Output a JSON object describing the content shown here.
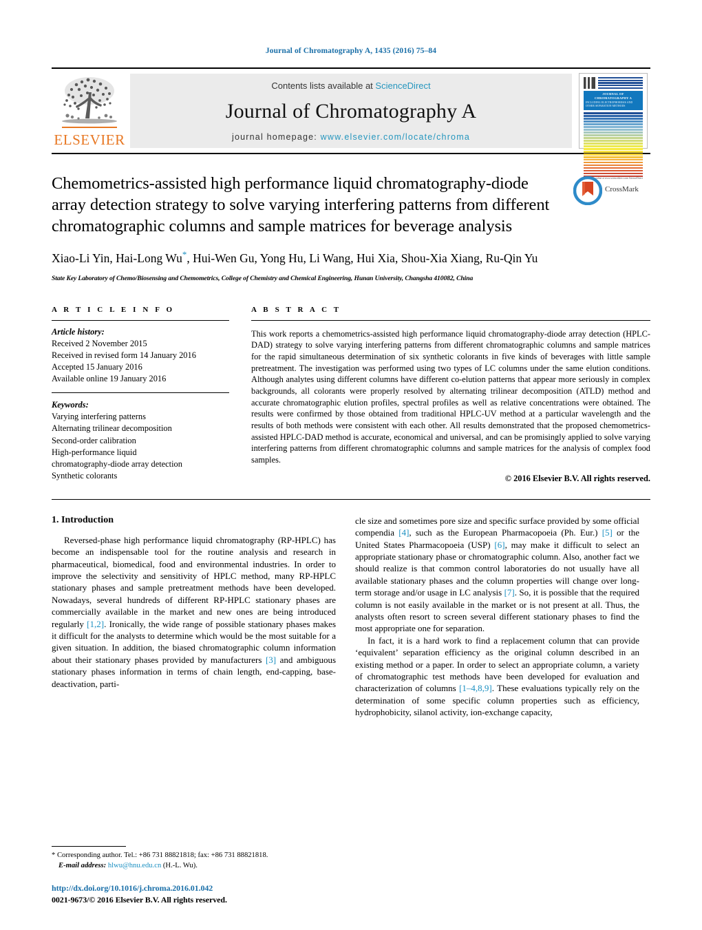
{
  "running_head": "Journal of Chromatography A, 1435 (2016) 75–84",
  "masthead": {
    "publisher_wordmark": "ELSEVIER",
    "contents_prefix": "Contents lists available at",
    "contents_link": "ScienceDirect",
    "journal_title": "Journal of Chromatography A",
    "homepage_prefix": "journal homepage:",
    "homepage_url": "www.elsevier.com/locate/chroma",
    "cover": {
      "title": "JOURNAL OF CHROMATOGRAPHY A",
      "subtitle": "INCLUDING ELECTROPHORESIS AND OTHER SEPARATION METHODS",
      "footer": "Available online at www.sciencedirect.com ScienceDirect",
      "stripe_colors": [
        "#1f4e96",
        "#2a62a8",
        "#3a78b8",
        "#4f8fc4",
        "#66a3cd",
        "#7fb4d4",
        "#94c0cf",
        "#a8c9be",
        "#b6cfa6",
        "#c3d58d",
        "#d2dc78",
        "#e0e263",
        "#ecea4f",
        "#f7ea3c",
        "#fbe13a",
        "#f9d23a",
        "#f7c23a",
        "#f4ae38",
        "#f09a36",
        "#ea8234",
        "#e36d34",
        "#da5a33",
        "#cf4b31",
        "#c44030"
      ]
    }
  },
  "crossmark": {
    "label": "CrossMark"
  },
  "article": {
    "title": "Chemometrics-assisted high performance liquid chromatography-diode array detection strategy to solve varying interfering patterns from different chromatographic columns and sample matrices for beverage analysis",
    "authors": "Xiao-Li Yin, Hai-Long Wu",
    "authors_rest": ", Hui-Wen Gu, Yong Hu, Li Wang, Hui Xia, Shou-Xia Xiang, Ru-Qin Yu",
    "corresponding_marker": "*",
    "affiliation": "State Key Laboratory of Chemo/Biosensing and Chemometrics, College of Chemistry and Chemical Engineering, Hunan University, Changsha 410082, China"
  },
  "article_info": {
    "heading": "A R T I C L E   I N F O",
    "history_label": "Article history:",
    "history": [
      "Received 2 November 2015",
      "Received in revised form 14 January 2016",
      "Accepted 15 January 2016",
      "Available online 19 January 2016"
    ],
    "keywords_label": "Keywords:",
    "keywords": [
      "Varying interfering patterns",
      "Alternating trilinear decomposition",
      "Second-order calibration",
      "High-performance liquid",
      "chromatography-diode array detection",
      "Synthetic colorants"
    ]
  },
  "abstract": {
    "heading": "A B S T R A C T",
    "text": "This work reports a chemometrics-assisted high performance liquid chromatography-diode array detection (HPLC-DAD) strategy to solve varying interfering patterns from different chromatographic columns and sample matrices for the rapid simultaneous determination of six synthetic colorants in five kinds of beverages with little sample pretreatment. The investigation was performed using two types of LC columns under the same elution conditions. Although analytes using different columns have different co-elution patterns that appear more seriously in complex backgrounds, all colorants were properly resolved by alternating trilinear decomposition (ATLD) method and accurate chromatographic elution profiles, spectral profiles as well as relative concentrations were obtained. The results were confirmed by those obtained from traditional HPLC-UV method at a particular wavelength and the results of both methods were consistent with each other. All results demonstrated that the proposed chemometrics-assisted HPLC-DAD method is accurate, economical and universal, and can be promisingly applied to solve varying interfering patterns from different chromatographic columns and sample matrices for the analysis of complex food samples.",
    "copyright": "© 2016 Elsevier B.V. All rights reserved."
  },
  "introduction": {
    "section_title": "1. Introduction",
    "left_para_1_a": "Reversed-phase high performance liquid chromatography (RP-HPLC) has become an indispensable tool for the routine analysis and research in pharmaceutical, biomedical, food and environmental industries. In order to improve the selectivity and sensitivity of HPLC method, many RP-HPLC stationary phases and sample pretreatment methods have been developed. Nowadays, several hundreds of different RP-HPLC stationary phases are commercially available in the market and new ones are being introduced regularly ",
    "ref_12": "[1,2]",
    "left_para_1_b": ". Ironically, the wide range of possible stationary phases makes it difficult for the analysts to determine which would be the most suitable for a given situation. In addition, the biased chromatographic column information about their stationary phases provided by manufacturers ",
    "ref_3": "[3]",
    "left_para_1_c": " and ambiguous stationary phases information in terms of chain length, end-capping, base-deactivation, parti-",
    "right_para_1_a": "cle size and sometimes pore size and specific surface provided by some official compendia ",
    "ref_4": "[4]",
    "right_para_1_b": ", such as the European Pharmacopoeia (Ph. Eur.) ",
    "ref_5": "[5]",
    "right_para_1_c": " or the United States Pharmacopoeia (USP) ",
    "ref_6": "[6]",
    "right_para_1_d": ", may make it difficult to select an appropriate stationary phase or chromatographic column. Also, another fact we should realize is that common control laboratories do not usually have all available stationary phases and the column properties will change over long-term storage and/or usage in LC analysis ",
    "ref_7": "[7]",
    "right_para_1_e": ". So, it is possible that the required column is not easily available in the market or is not present at all. Thus, the analysts often resort to screen several different stationary phases to find the most appropriate one for separation.",
    "right_para_2_a": "In fact, it is a hard work to find a replacement column that can provide ‘equivalent’ separation efficiency as the original column described in an existing method or a paper. In order to select an appropriate column, a variety of chromatographic test methods have been developed for evaluation and characterization of columns ",
    "ref_1489": "[1–4,8,9]",
    "right_para_2_b": ". These evaluations typically rely on the determination of some specific column properties such as efficiency, hydrophobicity, silanol activity, ion-exchange capacity,"
  },
  "footnote": {
    "marker": "*",
    "corresponding": "Corresponding author. Tel.: +86 731 88821818; fax: +86 731 88821818.",
    "email_label": "E-mail address:",
    "email": "hlwu@hnu.edu.cn",
    "email_suffix": "(H.-L. Wu)."
  },
  "doi_block": {
    "doi": "http://dx.doi.org/10.1016/j.chroma.2016.01.042",
    "issn": "0021-9673/© 2016 Elsevier B.V. All rights reserved."
  },
  "colors": {
    "link_blue": "#1a8fc1",
    "header_blue": "#1a6fa8",
    "elsevier_orange": "#E87722",
    "cover_band_blue": "#1278be"
  }
}
